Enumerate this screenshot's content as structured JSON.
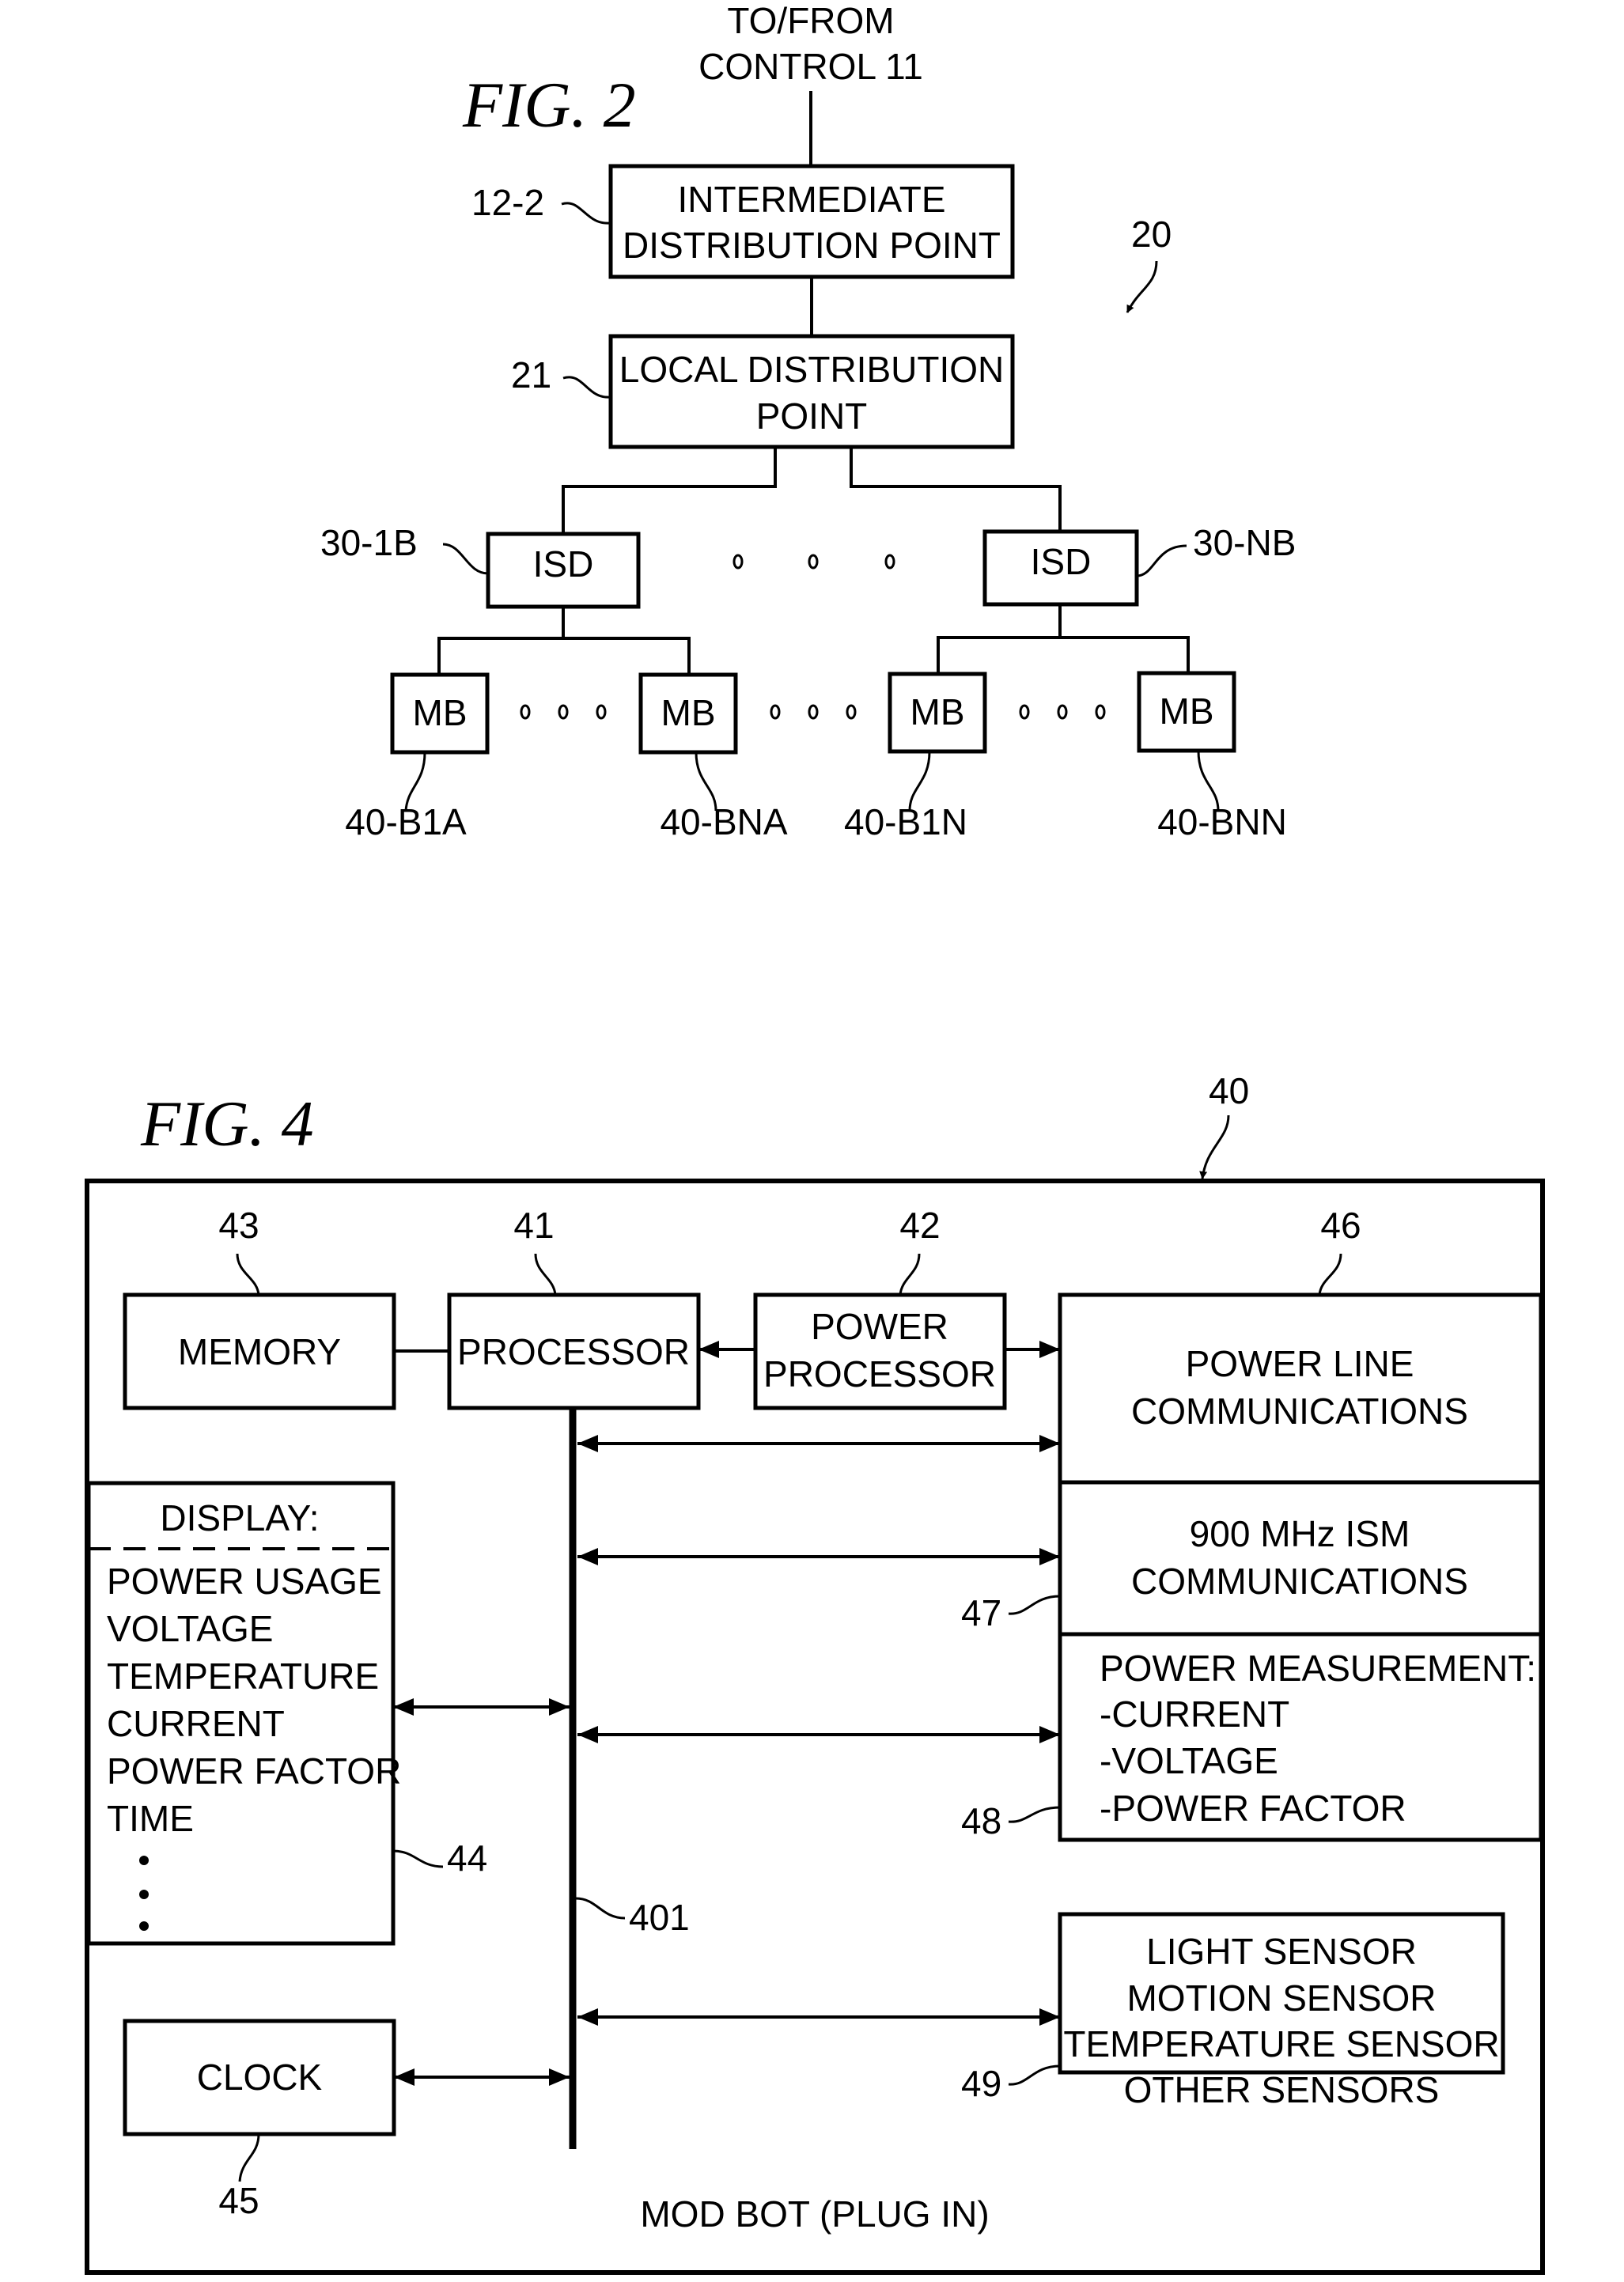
{
  "fig2": {
    "title": "FIG. 2",
    "ref_system": "20",
    "input_label_line1": "TO/FROM",
    "input_label_line2": "CONTROL 11",
    "intermediate": {
      "ref": "12-2",
      "line1": "INTERMEDIATE",
      "line2": "DISTRIBUTION POINT"
    },
    "local": {
      "ref": "21",
      "line1": "LOCAL DISTRIBUTION",
      "line2": "POINT"
    },
    "isd": [
      {
        "ref": "30-1B",
        "label": "ISD"
      },
      {
        "ref": "30-NB",
        "label": "ISD"
      }
    ],
    "mb": [
      {
        "ref": "40-B1A",
        "label": "MB"
      },
      {
        "ref": "40-BNA",
        "label": "MB"
      },
      {
        "ref": "40-B1N",
        "label": "MB"
      },
      {
        "ref": "40-BNN",
        "label": "MB"
      }
    ]
  },
  "fig4": {
    "title": "FIG. 4",
    "ref_device": "40",
    "device_label": "MOD BOT (PLUG IN)",
    "memory": {
      "ref": "43",
      "label": "MEMORY"
    },
    "processor": {
      "ref": "41",
      "label": "PROCESSOR"
    },
    "power_processor": {
      "ref": "42",
      "line1": "POWER",
      "line2": "PROCESSOR"
    },
    "plc": {
      "ref": "46",
      "line1": "POWER LINE",
      "line2": "COMMUNICATIONS"
    },
    "ism": {
      "ref": "47",
      "line1": "900 MHz ISM",
      "line2": "COMMUNICATIONS"
    },
    "measurement": {
      "ref": "48",
      "lines": [
        "POWER MEASUREMENT:",
        "-CURRENT",
        "-VOLTAGE",
        "-POWER FACTOR"
      ]
    },
    "display": {
      "ref": "44",
      "header": "DISPLAY:",
      "items": [
        "POWER USAGE",
        "VOLTAGE",
        "TEMPERATURE",
        "CURRENT",
        "POWER FACTOR",
        "TIME"
      ]
    },
    "bus": {
      "ref": "401"
    },
    "clock": {
      "ref": "45",
      "label": "CLOCK"
    },
    "sensors": {
      "ref": "49",
      "lines": [
        "LIGHT SENSOR",
        "MOTION SENSOR",
        "TEMPERATURE SENSOR",
        "OTHER SENSORS"
      ]
    }
  }
}
